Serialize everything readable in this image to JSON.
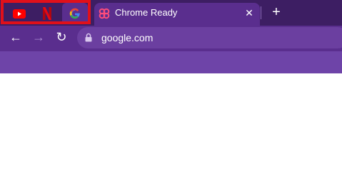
{
  "tabs": {
    "pinned": [
      {
        "icon": "youtube-icon"
      },
      {
        "icon": "netflix-icon"
      },
      {
        "icon": "google-icon"
      }
    ],
    "active": {
      "title": "Chrome Ready",
      "icon": "chrome-ready-icon"
    },
    "close_glyph": "✕",
    "new_tab_glyph": "+"
  },
  "toolbar": {
    "back_glyph": "←",
    "forward_glyph": "→",
    "reload_glyph": "↻",
    "url": "google.com"
  },
  "colors": {
    "tabstrip": "#3d1e63",
    "toolbar": "#5a2e8e",
    "omnibox": "#6b3fa0",
    "highlight": "#e0101a"
  }
}
